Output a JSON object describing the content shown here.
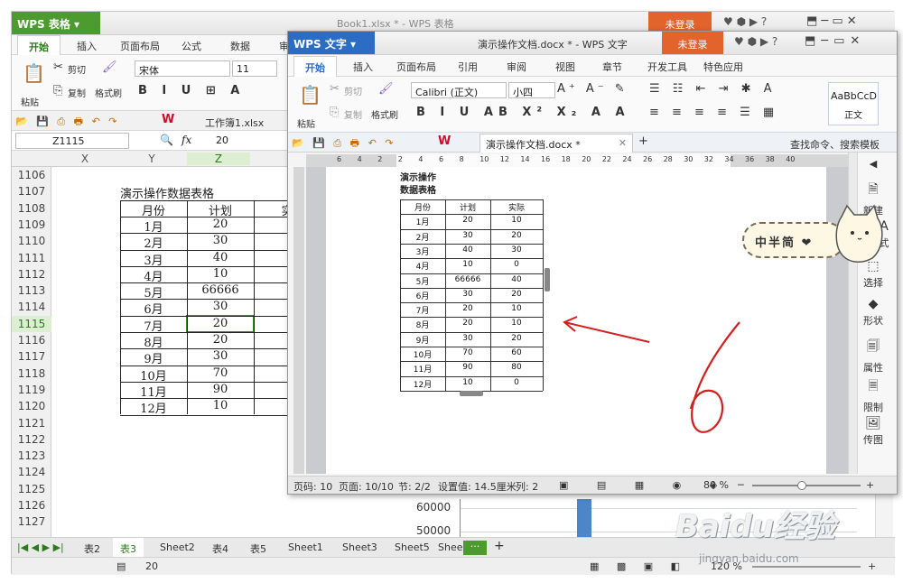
{
  "spreadsheet": {
    "app_button": "WPS 表格",
    "doc_title": "Book1.xlsx * - WPS 表格",
    "unlogged": "未登录",
    "tabs": [
      "开始",
      "插入",
      "页面布局",
      "公式",
      "数据",
      "审"
    ],
    "clipboard": {
      "paste": "粘贴",
      "cut": "剪切",
      "copy": "复制",
      "format_painter": "格式刷"
    },
    "font_name": "宋体",
    "font_size": "11",
    "file_tab": "工作簿1.xlsx",
    "name_box": "Z1115",
    "fx_label": "fx",
    "formula_value": "20",
    "columns": [
      "X",
      "Y",
      "Z"
    ],
    "row_numbers": [
      "1106",
      "1107",
      "1108",
      "1109",
      "1110",
      "1111",
      "1112",
      "1113",
      "1114",
      "1115",
      "1116",
      "1117",
      "1118",
      "1119",
      "1120",
      "1121",
      "1122",
      "1123",
      "1124",
      "1125",
      "1126",
      "1127"
    ],
    "table_title": "演示操作数据表格",
    "headers": [
      "月份",
      "计划",
      "实"
    ],
    "rows": [
      [
        "1月",
        "20"
      ],
      [
        "2月",
        "30"
      ],
      [
        "3月",
        "40"
      ],
      [
        "4月",
        "10"
      ],
      [
        "5月",
        "66666"
      ],
      [
        "6月",
        "30"
      ],
      [
        "7月",
        "20"
      ],
      [
        "8月",
        "20"
      ],
      [
        "9月",
        "30"
      ],
      [
        "10月",
        "70"
      ],
      [
        "11月",
        "90"
      ],
      [
        "12月",
        "10"
      ]
    ],
    "chart_ticks": [
      "60000",
      "50000"
    ],
    "sheet_tabs": [
      "表2",
      "表3",
      "Sheet2",
      "表4",
      "表5",
      "Sheet1",
      "Sheet3",
      "Sheet5",
      "Shee"
    ],
    "status_value": "20",
    "zoom": "120 %"
  },
  "writer": {
    "app_button": "WPS 文字",
    "doc_title": "演示操作文档.docx * - WPS 文字",
    "unlogged": "未登录",
    "tabs": [
      "开始",
      "插入",
      "页面布局",
      "引用",
      "审阅",
      "视图",
      "章节",
      "开发工具",
      "特色应用"
    ],
    "clipboard": {
      "paste": "粘贴",
      "cut": "剪切",
      "copy": "复制",
      "format_painter": "格式刷"
    },
    "font_name": "Calibri (正文)",
    "font_size": "小四",
    "style_preview": "AaBbCcD",
    "style_name": "正文",
    "doc_tab": "演示操作文档.docx *",
    "search": "查找命令、搜索模板",
    "ruler_numbers": [
      "6",
      "4",
      "2",
      "2",
      "4",
      "6",
      "8",
      "10",
      "12",
      "14",
      "16",
      "18",
      "20",
      "22",
      "24",
      "26",
      "28",
      "30",
      "32",
      "34",
      "36",
      "38",
      "40"
    ],
    "table_title": "演示操作数据表格",
    "table_title_lines": [
      "演示操作",
      "数据表格"
    ],
    "headers": [
      "月份",
      "计划",
      "实际"
    ],
    "rows": [
      [
        "1月",
        "20",
        "10"
      ],
      [
        "2月",
        "30",
        "20"
      ],
      [
        "3月",
        "40",
        "30"
      ],
      [
        "4月",
        "10",
        "0"
      ],
      [
        "5月",
        "66666",
        "40"
      ],
      [
        "6月",
        "30",
        "20"
      ],
      [
        "7月",
        "20",
        "10"
      ],
      [
        "8月",
        "20",
        "10"
      ],
      [
        "9月",
        "30",
        "20"
      ],
      [
        "10月",
        "70",
        "60"
      ],
      [
        "11月",
        "90",
        "80"
      ],
      [
        "12月",
        "10",
        "0"
      ]
    ],
    "sidebar": [
      "新建",
      "式",
      "选择",
      "形状",
      "属性",
      "限制",
      "传图"
    ],
    "status": {
      "page_num": "页码: 10",
      "pages": "页面: 10/10",
      "section": "节: 2/2",
      "setting": "设置值: 14.5厘米",
      "column": "列: 2",
      "zoom": "80 %"
    }
  },
  "sticker": {
    "text": "中半简 ❤"
  },
  "annotation": {
    "number": "6",
    "color": "#d21f1f"
  },
  "watermark": {
    "text": "Baidu经验",
    "sub": "jingyan.baidu.com"
  }
}
